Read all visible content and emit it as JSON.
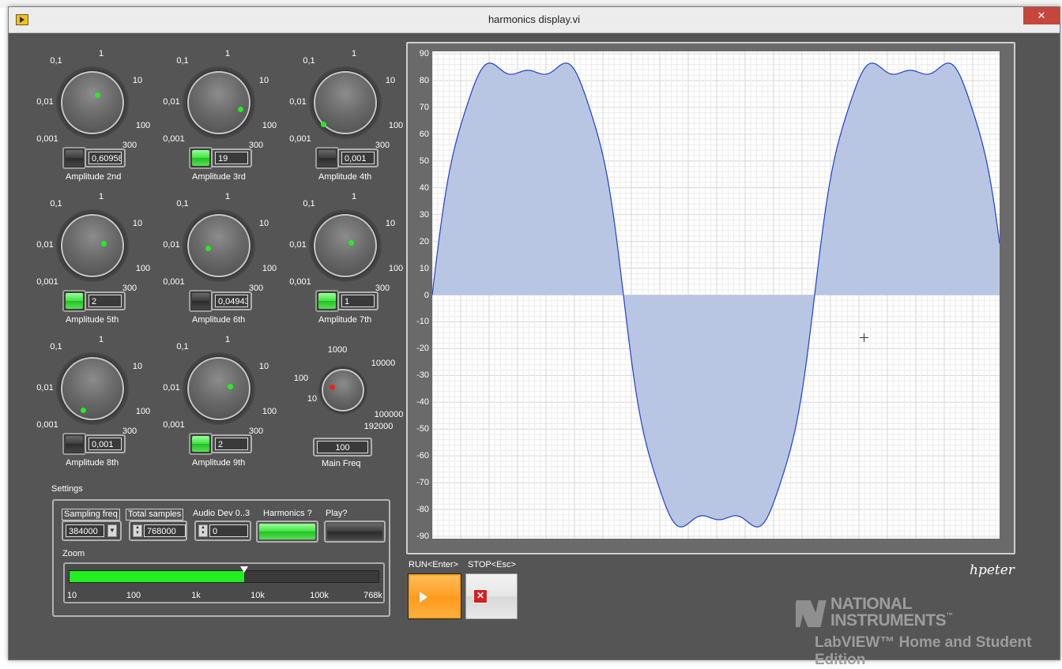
{
  "window": {
    "title": "harmonics display.vi",
    "close_glyph": "✕",
    "icon": "labview-vi-icon"
  },
  "knob_scale": [
    "0,001",
    "0,01",
    "0,1",
    "1",
    "10",
    "100",
    "300"
  ],
  "knobs": [
    {
      "label": "Amplitude 2nd",
      "value": "0,60958",
      "switch_on": false
    },
    {
      "label": "Amplitude 3rd",
      "value": "19",
      "switch_on": true
    },
    {
      "label": "Amplitude 4th",
      "value": "0,001",
      "switch_on": false
    },
    {
      "label": "Amplitude 5th",
      "value": "2",
      "switch_on": true
    },
    {
      "label": "Amplitude 6th",
      "value": "0,04943",
      "switch_on": false
    },
    {
      "label": "Amplitude 7th",
      "value": "1",
      "switch_on": true
    },
    {
      "label": "Amplitude 8th",
      "value": "0,001",
      "switch_on": false
    },
    {
      "label": "Amplitude 9th",
      "value": "2",
      "switch_on": true
    }
  ],
  "main_freq": {
    "label": "Main Freq",
    "value": "100",
    "scale": [
      "10",
      "100",
      "1000",
      "10000",
      "100000",
      "192000"
    ]
  },
  "settings": {
    "title": "Settings",
    "sampling_freq": {
      "label": "Sampling freq",
      "value": "384000"
    },
    "total_samples": {
      "label": "Total samples",
      "value": "768000"
    },
    "audio_dev": {
      "label": "Audio Dev 0..3",
      "value": "0"
    },
    "harmonics": {
      "label": "Harmonics ?",
      "on": true
    },
    "play": {
      "label": "Play?",
      "on": false
    },
    "zoom": {
      "label": "Zoom",
      "ticks": [
        "10",
        "100",
        "1k",
        "10k",
        "100k",
        "768k"
      ],
      "fill_fraction": 0.565
    }
  },
  "buttons": {
    "run": {
      "label": "RUN<Enter>",
      "icon": "play-icon"
    },
    "stop": {
      "label": "STOP<Esc>",
      "icon": "stop-x-icon",
      "glyph": "✕"
    }
  },
  "signature": "hpeter",
  "branding": {
    "line1": "NATIONAL",
    "line2": "INSTRUMENTS",
    "trademark": "™",
    "edition": "LabVIEW™ Home and Student Edition",
    "logo_icon": "ni-eagle-logo"
  },
  "chart_data": {
    "type": "area",
    "title": "",
    "xlabel": "",
    "ylabel": "",
    "ylim": [
      -90,
      90
    ],
    "yticks": [
      90,
      80,
      70,
      60,
      50,
      40,
      30,
      20,
      10,
      0,
      -10,
      -20,
      -30,
      -40,
      -50,
      -60,
      -70,
      -80,
      -90
    ],
    "grid": true,
    "fill_color": "#b9c6e3",
    "line_color": "#1f3fd0",
    "x_period_fraction": 0.674,
    "series": [
      {
        "shape": "fundamental plus odd harmonics",
        "harmonics": [
          {
            "n": 1,
            "amplitude": 100
          },
          {
            "n": 3,
            "amplitude": 19
          },
          {
            "n": 5,
            "amplitude": 2
          },
          {
            "n": 7,
            "amplitude": 1
          },
          {
            "n": 9,
            "amplitude": 2
          }
        ],
        "peak": 86.5
      }
    ]
  }
}
